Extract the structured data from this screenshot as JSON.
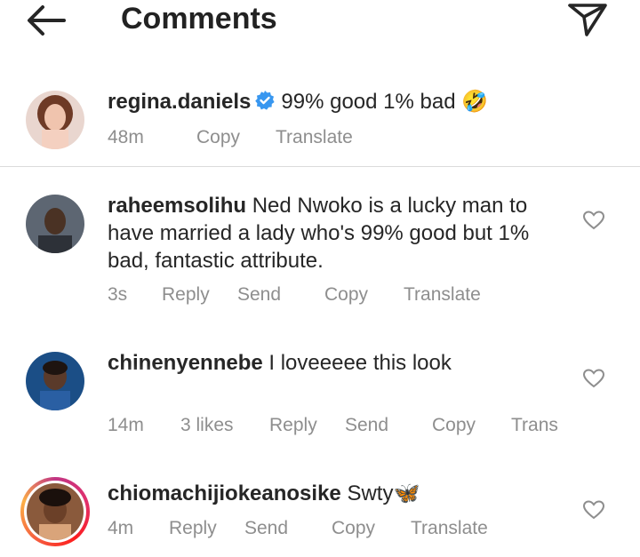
{
  "header": {
    "title": "Comments",
    "back_icon": "arrow-left-icon",
    "send_icon": "paper-plane-icon"
  },
  "caption": {
    "username": "regina.daniels",
    "text": "99% good 1% bad",
    "emoji": "🤣",
    "time": "48m",
    "copy": "Copy",
    "translate": "Translate"
  },
  "comments": [
    {
      "username": "raheemsolihu",
      "line1": "Ned Nwoko is a lucky man to",
      "line2": "have married a lady who's 99% good but 1%",
      "line3": "bad, fantastic attribute.",
      "time": "3s",
      "reply": "Reply",
      "send": "Send",
      "copy": "Copy",
      "translate": "Translate"
    },
    {
      "username": "chinenyennebe",
      "text": "I loveeeee this look",
      "time": "14m",
      "likes": "3 likes",
      "reply": "Reply",
      "send": "Send",
      "copy": "Copy",
      "translate": "Trans"
    },
    {
      "username": "chiomachijiokeanosike",
      "text": "Swty",
      "emoji": "🦋",
      "time": "4m",
      "reply": "Reply",
      "send": "Send",
      "copy": "Copy",
      "translate": "Translate"
    }
  ],
  "colors": {
    "text": "#262626",
    "meta": "#8e8e8e",
    "verified": "#3897f0",
    "divider": "#dbdbdb"
  }
}
